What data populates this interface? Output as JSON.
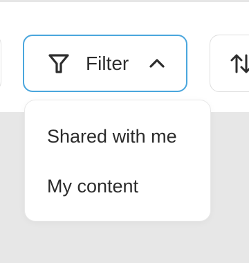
{
  "toolbar": {
    "filter_label": "Filter",
    "filter_icon": "filter-icon",
    "chevron_icon": "chevron-up-icon",
    "sort_icon": "sort-icon",
    "active_accent": "#4aa6dd"
  },
  "dropdown": {
    "items": [
      {
        "label": "Shared with me"
      },
      {
        "label": "My content"
      }
    ]
  }
}
